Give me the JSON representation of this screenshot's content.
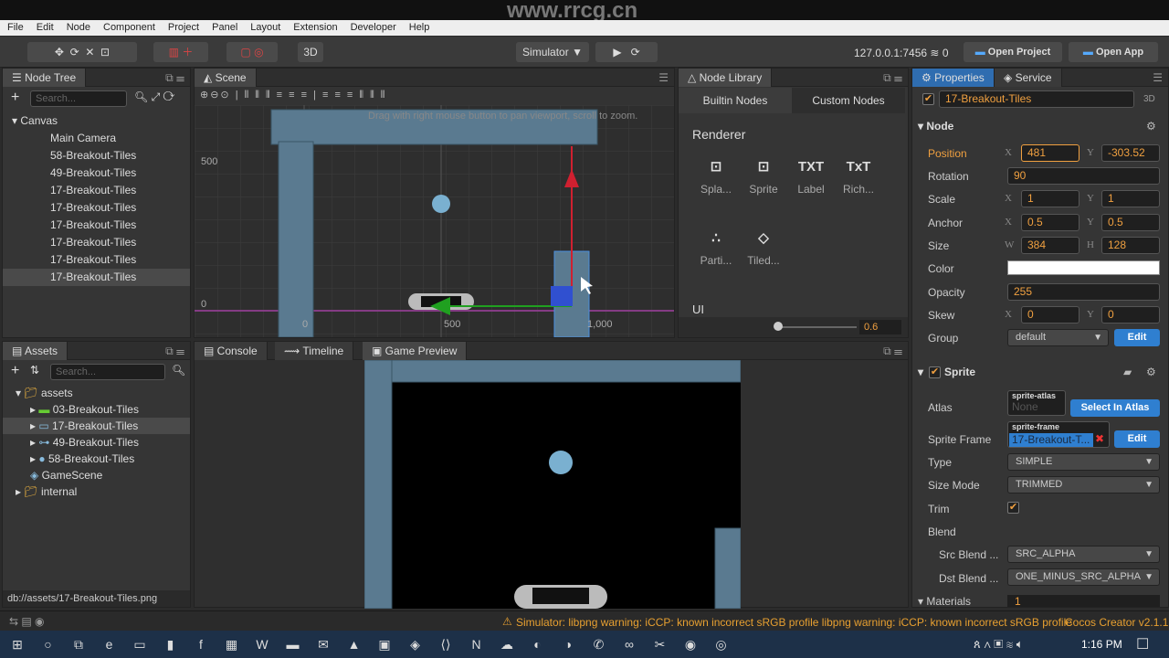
{
  "watermark": "www.rrcg.cn",
  "menu": [
    "File",
    "Edit",
    "Node",
    "Component",
    "Project",
    "Panel",
    "Layout",
    "Extension",
    "Developer",
    "Help"
  ],
  "toolbar": {
    "mode3d": "3D",
    "simulator": "Simulator",
    "ip": "127.0.0.1:7456",
    "wifi_count": "0",
    "open_project": "Open Project",
    "open_app": "Open App"
  },
  "node_tree": {
    "title": "Node Tree",
    "search_placeholder": "Search...",
    "items": [
      {
        "label": "Canvas",
        "level": 0
      },
      {
        "label": "Main Camera",
        "level": 1
      },
      {
        "label": "58-Breakout-Tiles",
        "level": 1
      },
      {
        "label": "49-Breakout-Tiles",
        "level": 1
      },
      {
        "label": "17-Breakout-Tiles",
        "level": 1
      },
      {
        "label": "17-Breakout-Tiles",
        "level": 1
      },
      {
        "label": "17-Breakout-Tiles",
        "level": 1
      },
      {
        "label": "17-Breakout-Tiles",
        "level": 1
      },
      {
        "label": "17-Breakout-Tiles",
        "level": 1
      },
      {
        "label": "17-Breakout-Tiles",
        "level": 1,
        "selected": true
      }
    ]
  },
  "scene": {
    "title": "Scene",
    "hint": "Drag with right mouse button to pan viewport, scroll to zoom.",
    "y_labels": [
      "500",
      "0"
    ],
    "x_labels": [
      "0",
      "500",
      "1,000"
    ]
  },
  "node_library": {
    "title": "Node Library",
    "tabs": [
      "Builtin Nodes",
      "Custom Nodes"
    ],
    "section_renderer": "Renderer",
    "section_ui": "UI",
    "items": [
      {
        "icon": "⊡",
        "label": "Spla..."
      },
      {
        "icon": "⊡",
        "label": "Sprite"
      },
      {
        "icon": "TXT",
        "label": "Label"
      },
      {
        "icon": "TxT",
        "label": "Rich..."
      },
      {
        "icon": "∴",
        "label": "Parti..."
      },
      {
        "icon": "◇",
        "label": "Tiled..."
      }
    ],
    "zoom": "0.6"
  },
  "assets": {
    "title": "Assets",
    "search_placeholder": "Search...",
    "items": [
      {
        "label": "assets",
        "level": 0
      },
      {
        "label": "03-Breakout-Tiles",
        "level": 1
      },
      {
        "label": "17-Breakout-Tiles",
        "level": 1,
        "selected": true
      },
      {
        "label": "49-Breakout-Tiles",
        "level": 1
      },
      {
        "label": "58-Breakout-Tiles",
        "level": 1
      },
      {
        "label": "GameScene",
        "level": 1
      },
      {
        "label": "internal",
        "level": 0
      }
    ],
    "path": "db://assets/17-Breakout-Tiles.png"
  },
  "bottom_tabs": [
    "Console",
    "Timeline",
    "Game Preview"
  ],
  "properties": {
    "tabs": [
      "Properties",
      "Service"
    ],
    "node_name": "17-Breakout-Tiles",
    "mode": "3D",
    "node_section": "Node",
    "position": {
      "label": "Position",
      "x": "481",
      "y": "-303.52"
    },
    "rotation": {
      "label": "Rotation",
      "value": "90"
    },
    "scale": {
      "label": "Scale",
      "x": "1",
      "y": "1"
    },
    "anchor": {
      "label": "Anchor",
      "x": "0.5",
      "y": "0.5"
    },
    "size": {
      "label": "Size",
      "w": "384",
      "h": "128"
    },
    "color": {
      "label": "Color",
      "value": "#ffffff"
    },
    "opacity": {
      "label": "Opacity",
      "value": "255"
    },
    "skew": {
      "label": "Skew",
      "x": "0",
      "y": "0"
    },
    "group": {
      "label": "Group",
      "value": "default",
      "edit": "Edit"
    },
    "sprite_section": "Sprite",
    "atlas": {
      "label": "Atlas",
      "tag": "sprite-atlas",
      "value": "None",
      "button": "Select In Atlas"
    },
    "sprite_frame": {
      "label": "Sprite Frame",
      "tag": "sprite-frame",
      "value": "17-Breakout-T...",
      "button": "Edit"
    },
    "type": {
      "label": "Type",
      "value": "SIMPLE"
    },
    "size_mode": {
      "label": "Size Mode",
      "value": "TRIMMED"
    },
    "trim": {
      "label": "Trim",
      "checked": true
    },
    "blend": {
      "label": "Blend"
    },
    "src_blend": {
      "label": "Src Blend ...",
      "value": "SRC_ALPHA"
    },
    "dst_blend": {
      "label": "Dst Blend ...",
      "value": "ONE_MINUS_SRC_ALPHA"
    },
    "materials": {
      "label": "Materials",
      "value": "1"
    }
  },
  "status": {
    "message": "Simulator: libpng warning: iCCP: known incorrect sRGB profile libpng warning: iCCP: known incorrect sRGB profile",
    "version": "Cocos Creator v2.1.1"
  },
  "taskbar": {
    "time": "1:16 PM"
  },
  "colors": {
    "accent": "#f0a040",
    "selection_blue": "#2f7fd0",
    "panel": "#353535"
  }
}
